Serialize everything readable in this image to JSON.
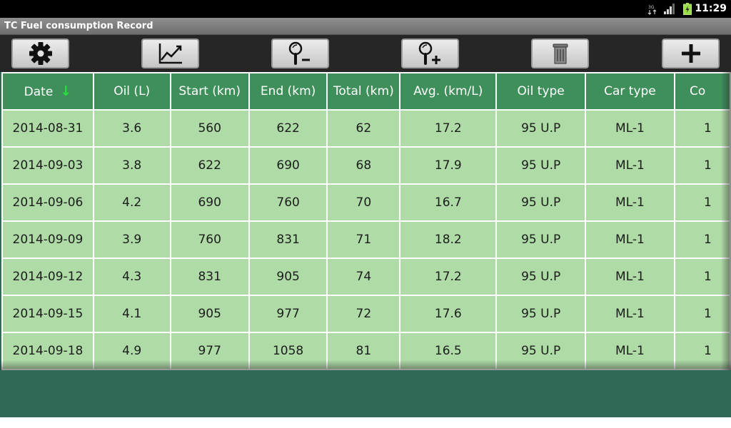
{
  "status_bar": {
    "time": "11:29"
  },
  "app": {
    "title": "TC Fuel consumption Record"
  },
  "toolbar": {
    "buttons": [
      {
        "icon": "gear-icon"
      },
      {
        "icon": "chart-icon"
      },
      {
        "icon": "zoom-out-icon"
      },
      {
        "icon": "zoom-in-icon"
      },
      {
        "icon": "trash-icon"
      },
      {
        "icon": "plus-icon"
      }
    ]
  },
  "table": {
    "sort_indicator": "↓",
    "columns": [
      "Date",
      "Oil (L)",
      "Start (km)",
      "End (km)",
      "Total (km)",
      "Avg. (km/L)",
      "Oil type",
      "Car type",
      "Co"
    ],
    "rows": [
      [
        "2014-08-31",
        "3.6",
        "560",
        "622",
        "62",
        "17.2",
        "95 U.P",
        "ML-1",
        "1"
      ],
      [
        "2014-09-03",
        "3.8",
        "622",
        "690",
        "68",
        "17.9",
        "95 U.P",
        "ML-1",
        "1"
      ],
      [
        "2014-09-06",
        "4.2",
        "690",
        "760",
        "70",
        "16.7",
        "95 U.P",
        "ML-1",
        "1"
      ],
      [
        "2014-09-09",
        "3.9",
        "760",
        "831",
        "71",
        "18.2",
        "95 U.P",
        "ML-1",
        "1"
      ],
      [
        "2014-09-12",
        "4.3",
        "831",
        "905",
        "74",
        "17.2",
        "95 U.P",
        "ML-1",
        "1"
      ],
      [
        "2014-09-15",
        "4.1",
        "905",
        "977",
        "72",
        "17.6",
        "95 U.P",
        "ML-1",
        "1"
      ],
      [
        "2014-09-18",
        "4.9",
        "977",
        "1058",
        "81",
        "16.5",
        "95 U.P",
        "ML-1",
        "1"
      ]
    ]
  },
  "colors": {
    "header_bg": "#3f8f5b",
    "row_bg": "#aedba6",
    "sort_arrow": "#27e03a",
    "background": "#2f6a56"
  }
}
